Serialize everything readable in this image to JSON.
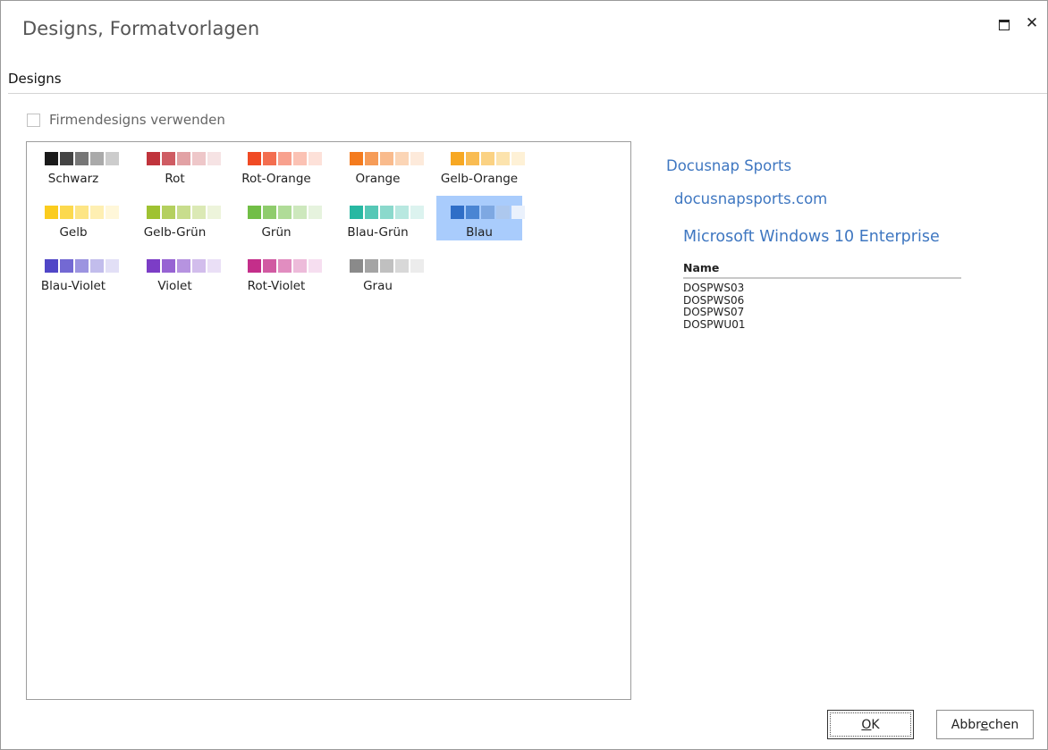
{
  "window": {
    "title": "Designs, Formatvorlagen",
    "maximize_icon": "maximize-icon",
    "close_icon": "close-icon",
    "close_glyph": "✕"
  },
  "section": {
    "label": "Designs"
  },
  "checkbox": {
    "label": "Firmendesigns verwenden",
    "checked": false
  },
  "designs": [
    {
      "name": "Schwarz",
      "colors": [
        "#1a1a1a",
        "#444444",
        "#777777",
        "#aaaaaa",
        "#cccccc"
      ]
    },
    {
      "name": "Rot",
      "colors": [
        "#c0343c",
        "#cf5c63",
        "#e2a2a5",
        "#eec7c9",
        "#f6e3e4"
      ]
    },
    {
      "name": "Rot-Orange",
      "colors": [
        "#f04a24",
        "#f36e50",
        "#f8a18e",
        "#fbc2b4",
        "#fde1d9"
      ]
    },
    {
      "name": "Orange",
      "colors": [
        "#f47b1e",
        "#f69c58",
        "#f9bb8d",
        "#fbd5b6",
        "#fdeadb"
      ]
    },
    {
      "name": "Gelb-Orange",
      "colors": [
        "#f7a823",
        "#f9bc52",
        "#fbd283",
        "#fce3ad",
        "#fef1d6"
      ]
    },
    {
      "name": "Gelb",
      "colors": [
        "#fbcc1e",
        "#fcd94e",
        "#fde585",
        "#feefb2",
        "#fff7d9"
      ]
    },
    {
      "name": "Gelb-Grün",
      "colors": [
        "#9fc232",
        "#b4d05f",
        "#c8dd8d",
        "#dbe9b5",
        "#edf4db"
      ]
    },
    {
      "name": "Grün",
      "colors": [
        "#71be46",
        "#8fcc6d",
        "#b0dc98",
        "#cde8bd",
        "#e6f3de"
      ]
    },
    {
      "name": "Blau-Grün",
      "colors": [
        "#28b8a2",
        "#56c8b6",
        "#8bd9cc",
        "#b8e8e0",
        "#dcf3ef"
      ]
    },
    {
      "name": "Blau",
      "colors": [
        "#2f6ec7",
        "#4a85d3",
        "#7ea8e2",
        "#adc8ee",
        "#eaf1fc"
      ]
    },
    {
      "name": "Blau-Violet",
      "colors": [
        "#5046c7",
        "#7369d3",
        "#9c94e0",
        "#c2bdec",
        "#e2dff6"
      ]
    },
    {
      "name": "Violet",
      "colors": [
        "#7c3dc6",
        "#9763d3",
        "#b693e0",
        "#d2bdec",
        "#eadff6"
      ]
    },
    {
      "name": "Rot-Violet",
      "colors": [
        "#c42e8a",
        "#d15aa2",
        "#e18dc0",
        "#edbbda",
        "#f6def0"
      ]
    },
    {
      "name": "Grau",
      "colors": [
        "#8a8a8a",
        "#a4a4a4",
        "#c0c0c0",
        "#d8d8d8",
        "#ececec"
      ]
    }
  ],
  "selected_design": "Blau",
  "preview": {
    "title": "Docusnap Sports",
    "subtitle": "docusnapsports.com",
    "os": "Microsoft Windows 10 Enterprise",
    "table_header": "Name",
    "rows": [
      "DOSPWS03",
      "DOSPWS06",
      "DOSPWS07",
      "DOSPWU01"
    ]
  },
  "buttons": {
    "ok": {
      "label": "OK",
      "mnemonic": "O"
    },
    "cancel": {
      "label": "Abbrechen",
      "mnemonic": "e"
    }
  }
}
